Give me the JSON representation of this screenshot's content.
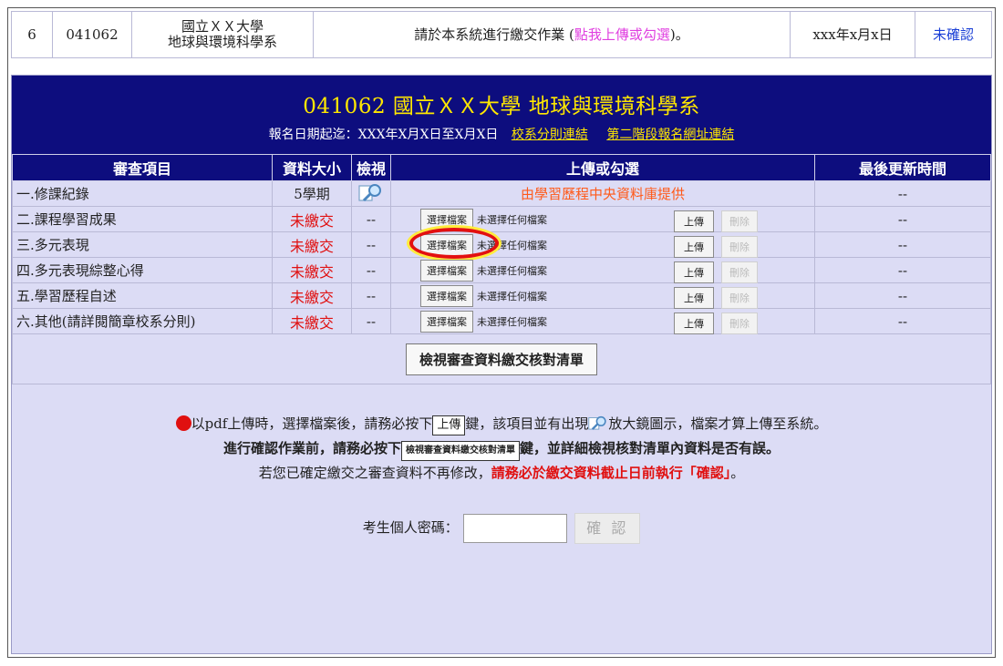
{
  "top": {
    "num": "6",
    "code": "041062",
    "school_line1": "國立ＸＸ大學",
    "school_line2": "地球與環境科學系",
    "instruction_prefix": "請於本系統進行繳交作業 (",
    "instruction_link": "點我上傳或勾選",
    "instruction_suffix": ")。",
    "date": "xxx年x月x日",
    "status": "未確認"
  },
  "header": {
    "title": "041062 國立ＸＸ大學 地球與環境科學系",
    "reg_date": "報名日期起迄：XXX年X月X日至X月X日",
    "link1": "校系分則連結",
    "link2": "第二階段報名網址連結"
  },
  "columns": [
    "審查項目",
    "資料大小",
    "檢視",
    "上傳或勾選",
    "最後更新時間"
  ],
  "rows": [
    {
      "item": "一.修課紀錄",
      "size": "5學期",
      "view": "",
      "upload": "由學習歷程中央資料庫提供",
      "time": "--"
    },
    {
      "item": "二.課程學習成果",
      "size": "未繳交",
      "view": "--",
      "upload": "",
      "time": "--"
    },
    {
      "item": "三.多元表現",
      "size": "未繳交",
      "view": "--",
      "upload": "",
      "time": "--"
    },
    {
      "item": "四.多元表現綜整心得",
      "size": "未繳交",
      "view": "--",
      "upload": "",
      "time": "--"
    },
    {
      "item": "五.學習歷程自述",
      "size": "未繳交",
      "view": "--",
      "upload": "",
      "time": "--"
    },
    {
      "item": "六.其他(請詳閱簡章校系分則)",
      "size": "未繳交",
      "view": "--",
      "upload": "",
      "time": "--"
    }
  ],
  "file_controls": {
    "choose": "選擇檔案",
    "no_file": "未選擇任何檔案",
    "upload": "上傳",
    "delete": "刪除"
  },
  "check_button": "檢視審查資料繳交核對清單",
  "notes": {
    "line1_a": "以pdf上傳時，選擇檔案後，請務必按下",
    "line1_btn": "上傳",
    "line1_b": "鍵，該項目並有出現",
    "line1_c": "放大鏡圖示，檔案才算上傳至系統。",
    "line2_a": "進行確認作業前，請務必按下",
    "line2_btn": "檢視審查資料繳交核對清單",
    "line2_b": "鍵，並詳細檢視核對清單內資料是否有誤。",
    "line3_a": "若您已確定繳交之審查資料不再修改，",
    "line3_red": "請務必於繳交資料截止日前執行「確認」",
    "line3_b": "。"
  },
  "password": {
    "label": "考生個人密碼：",
    "confirm": "確 認"
  },
  "colors": {
    "header_bg": "#0d0d7e",
    "header_title": "#ffe700",
    "panel_bg": "#dcdcf5",
    "not_submitted": "#e01010",
    "highlight_ring": "#e31010"
  }
}
